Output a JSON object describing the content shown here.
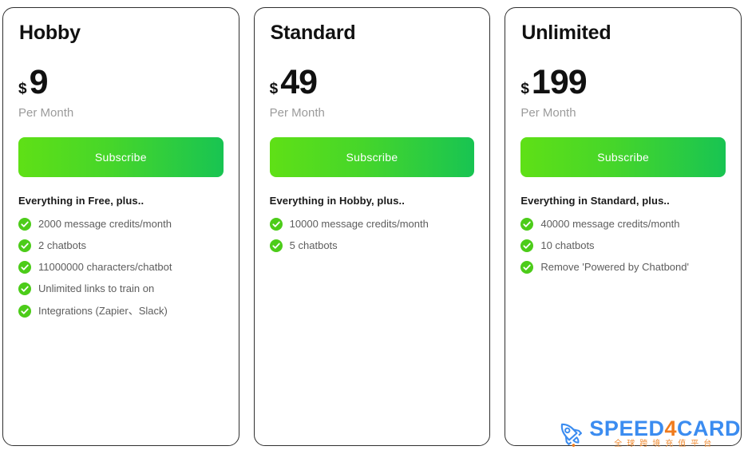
{
  "page": {
    "background_color": "#ffffff",
    "accent_gradient_from": "#5fe016",
    "accent_gradient_to": "#18c452",
    "check_icon_color": "#4ccc19",
    "card_border_color": "#2f2f2f"
  },
  "plans": [
    {
      "name": "Hobby",
      "currency": "$",
      "amount": "9",
      "period": "Per Month",
      "cta_label": "Subscribe",
      "features_heading": "Everything in Free, plus..",
      "features": [
        "2000 message credits/month",
        "2 chatbots",
        "11000000 characters/chatbot",
        "Unlimited links to train on",
        "Integrations (Zapier、Slack)"
      ]
    },
    {
      "name": "Standard",
      "currency": "$",
      "amount": "49",
      "period": "Per Month",
      "cta_label": "Subscribe",
      "features_heading": "Everything in Hobby, plus..",
      "features": [
        "10000 message credits/month",
        "5 chatbots"
      ]
    },
    {
      "name": "Unlimited",
      "currency": "$",
      "amount": "199",
      "period": "Per Month",
      "cta_label": "Subscribe",
      "features_heading": "Everything in Standard, plus..",
      "features": [
        "40000 message credits/month",
        "10 chatbots",
        "Remove 'Powered by Chatbond'"
      ]
    }
  ],
  "watermark": {
    "icon": "rocket-icon",
    "title_part1": "SPEED",
    "title_highlight": "4",
    "title_part2": "CARD",
    "subtitle": "全球跨境充值平台",
    "brand_color": "#3b8cf0",
    "highlight_color": "#f07c1e",
    "subtitle_color": "#f08c33"
  }
}
